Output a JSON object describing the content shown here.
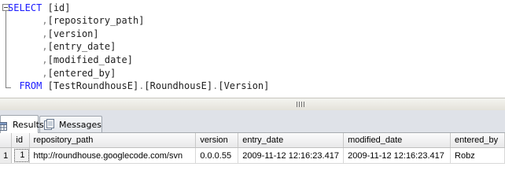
{
  "editor": {
    "lines": [
      [
        {
          "t": "SELECT",
          "c": "kw"
        },
        {
          "t": " ",
          "c": "id"
        },
        {
          "t": "[id]",
          "c": "id"
        }
      ],
      [
        {
          "t": "      ",
          "c": "id"
        },
        {
          "t": ",",
          "c": "pn"
        },
        {
          "t": "[repository_path]",
          "c": "id"
        }
      ],
      [
        {
          "t": "      ",
          "c": "id"
        },
        {
          "t": ",",
          "c": "pn"
        },
        {
          "t": "[version]",
          "c": "id"
        }
      ],
      [
        {
          "t": "      ",
          "c": "id"
        },
        {
          "t": ",",
          "c": "pn"
        },
        {
          "t": "[entry_date]",
          "c": "id"
        }
      ],
      [
        {
          "t": "      ",
          "c": "id"
        },
        {
          "t": ",",
          "c": "pn"
        },
        {
          "t": "[modified_date]",
          "c": "id"
        }
      ],
      [
        {
          "t": "      ",
          "c": "id"
        },
        {
          "t": ",",
          "c": "pn"
        },
        {
          "t": "[entered_by]",
          "c": "id"
        }
      ],
      [
        {
          "t": "  FROM",
          "c": "kw"
        },
        {
          "t": " ",
          "c": "id"
        },
        {
          "t": "[TestRoundhousE]",
          "c": "id"
        },
        {
          "t": ".",
          "c": "pn"
        },
        {
          "t": "[RoundhousE]",
          "c": "id"
        },
        {
          "t": ".",
          "c": "pn"
        },
        {
          "t": "[Version]",
          "c": "id"
        }
      ]
    ]
  },
  "tabs": {
    "results_label": "Results",
    "messages_label": "Messages"
  },
  "grid": {
    "columns": [
      "id",
      "repository_path",
      "version",
      "entry_date",
      "modified_date",
      "entered_by"
    ],
    "rows": [
      {
        "num": "1",
        "cells": [
          "1",
          "http://roundhouse.googlecode.com/svn",
          "0.0.0.55",
          "2009-11-12 12:16:23.417",
          "2009-11-12 12:16:23.417",
          "Robz"
        ]
      }
    ]
  },
  "colors": {
    "keyword": "#1a1aff",
    "punctuation": "#808080",
    "identifier": "#202020"
  },
  "icons": {
    "results_tab": "grid-icon",
    "messages_tab": "messages-icon",
    "editor_collapse": "collapse-minus-icon",
    "splitter_grip": "splitter-grip-icon"
  }
}
